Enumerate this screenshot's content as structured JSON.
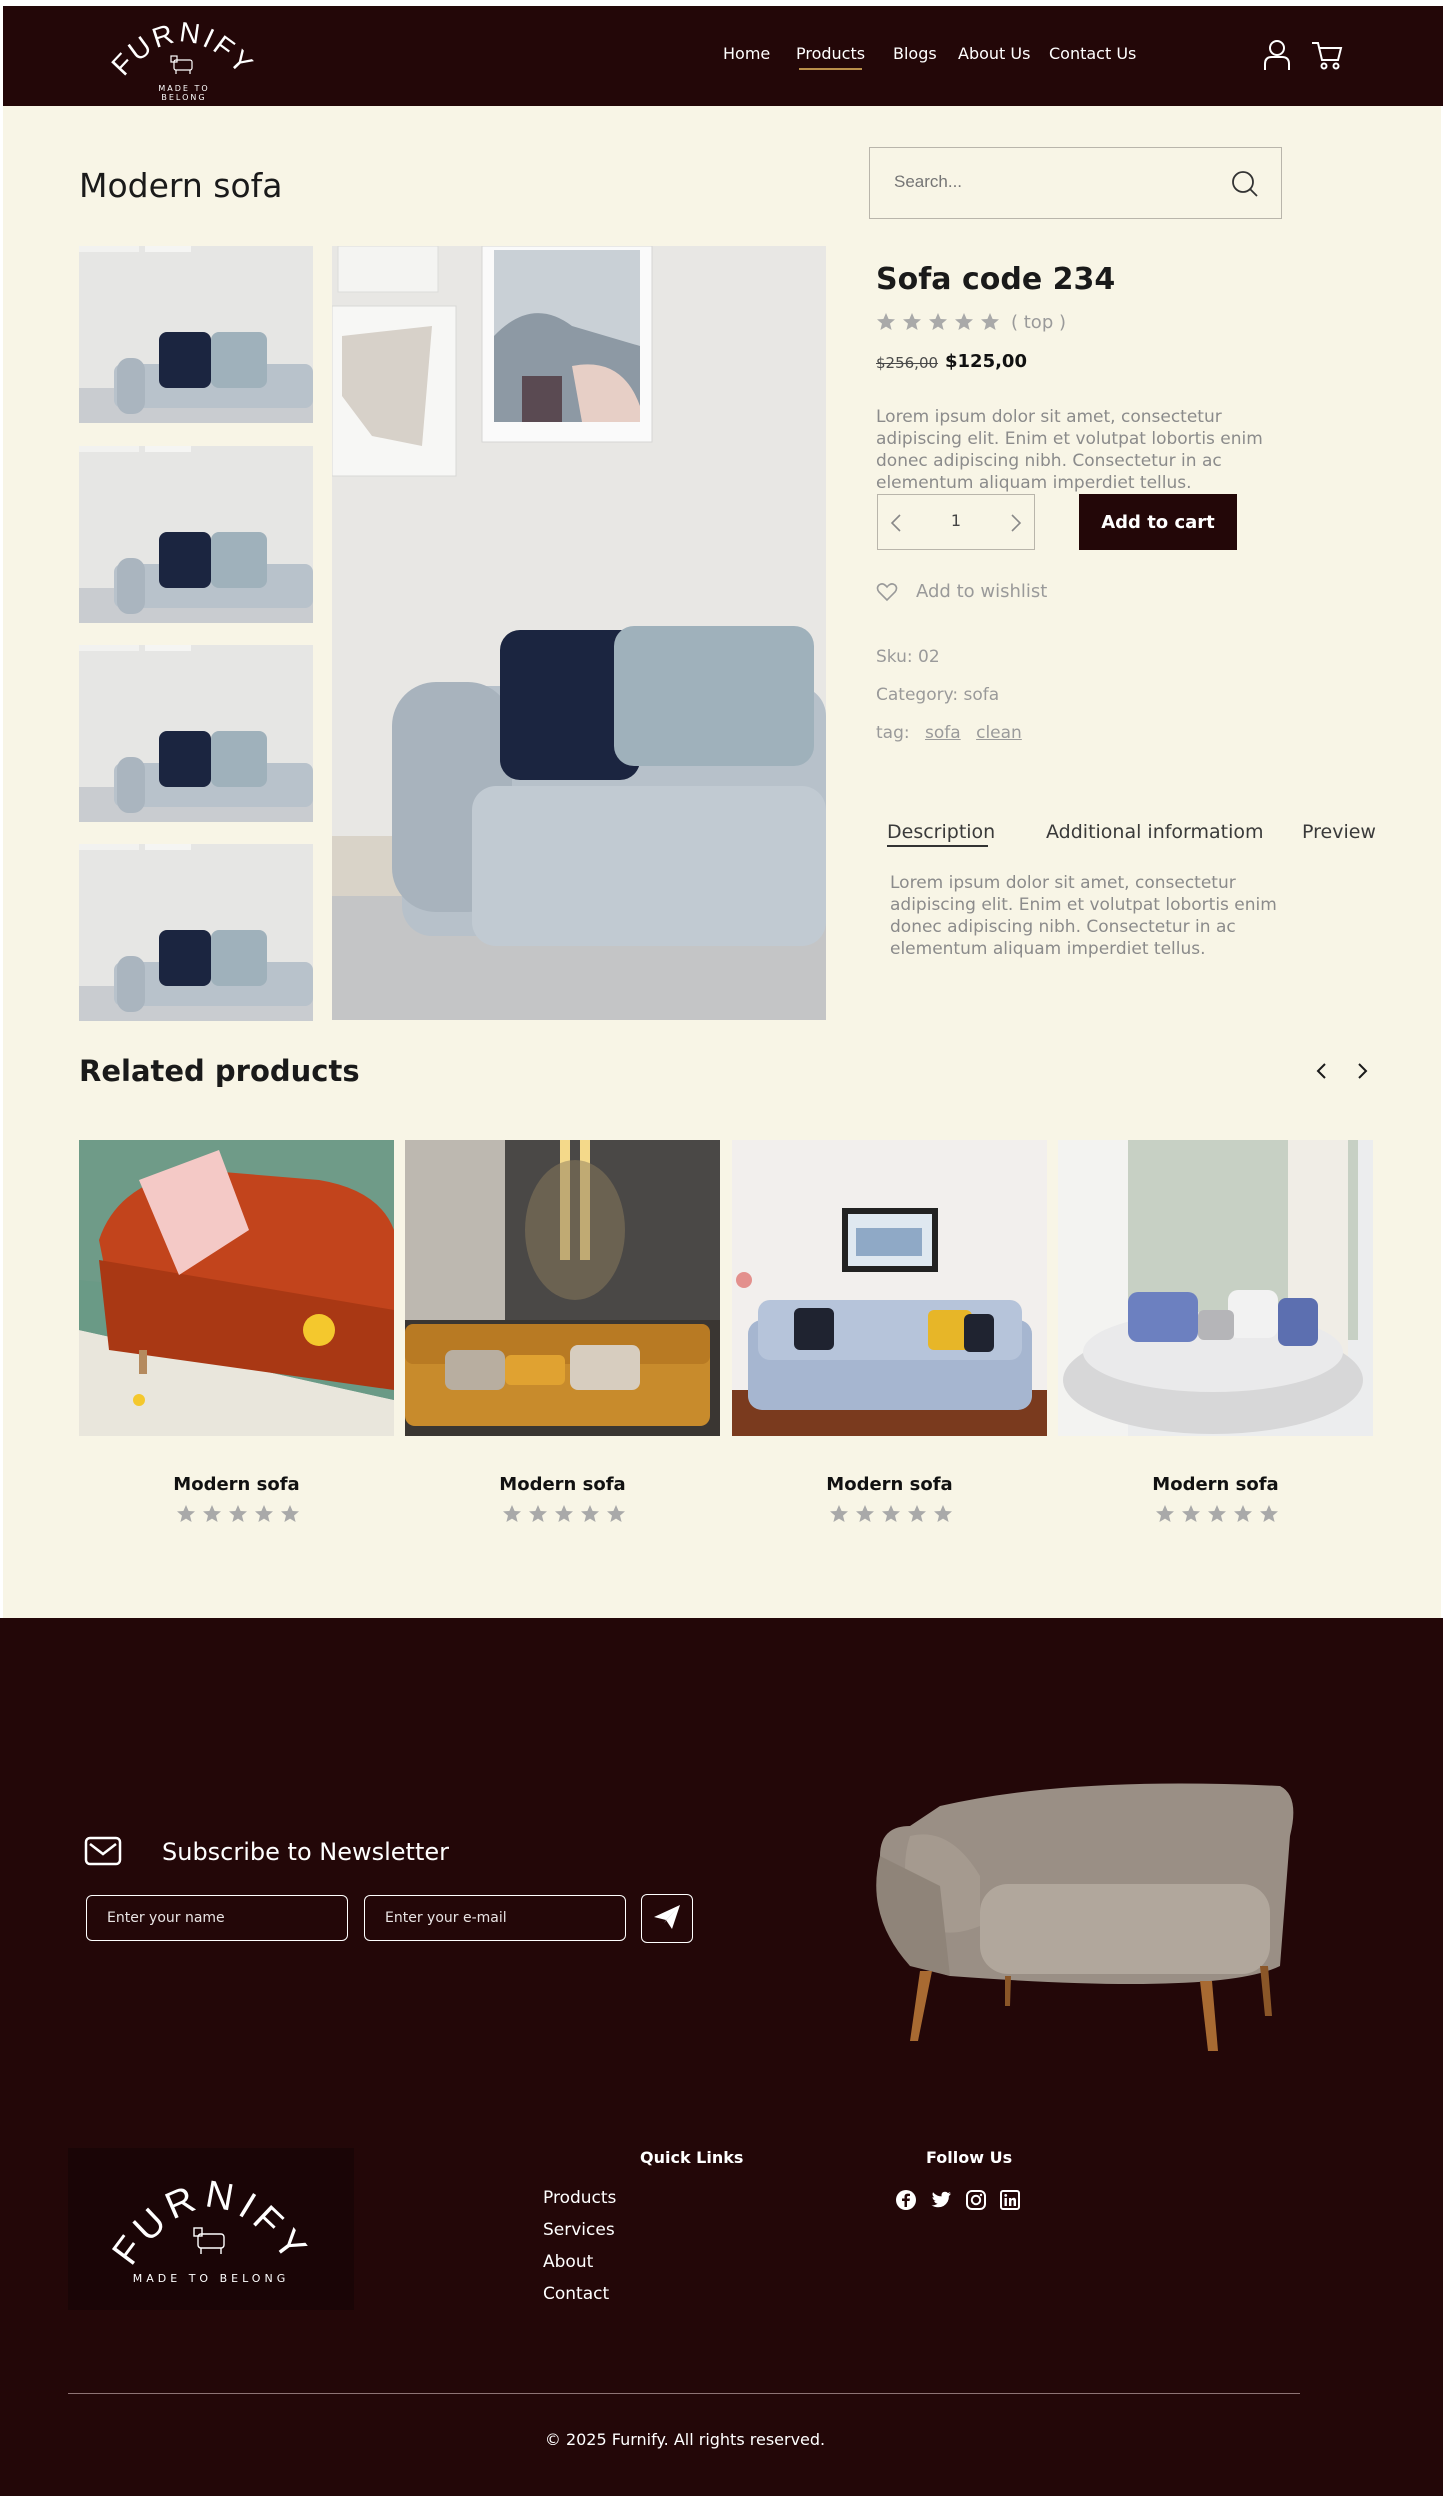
{
  "header": {
    "logo_text": "FURNIFY",
    "logo_tagline": "MADE TO BELONG",
    "nav": [
      "Home",
      "Products",
      "Blogs",
      "About Us",
      "Contact Us"
    ],
    "active_nav": "Products",
    "icons": [
      "user-icon",
      "cart-icon"
    ]
  },
  "page": {
    "title": "Modern sofa",
    "search_placeholder": "Search..."
  },
  "product": {
    "name": "Sofa code 234",
    "rating_label": "( top )",
    "rating_stars": 5,
    "old_price": "$256,00",
    "price": "$125,00",
    "description": "Lorem ipsum dolor sit amet, consectetur adipiscing elit. Enim et volutpat lobortis enim donec adipiscing nibh. Consectetur in ac elementum aliquam imperdiet tellus.",
    "quantity": "1",
    "add_to_cart": "Add to cart",
    "wishlist": "Add to wishlist",
    "sku": "Sku: 02",
    "category": "Category: sofa",
    "tag_label": "tag:",
    "tags": [
      "sofa",
      "clean"
    ]
  },
  "tabs": {
    "items": [
      "Description",
      "Additional informatiom",
      "Preview"
    ],
    "active": "Description",
    "content": "Lorem ipsum dolor sit amet, consectetur adipiscing elit. Enim et volutpat lobortis enim donec adipiscing nibh. Consectetur in ac elementum aliquam imperdiet tellus."
  },
  "related": {
    "title": "Related products",
    "items": [
      {
        "name": "Modern sofa",
        "stars": 5
      },
      {
        "name": "Modern sofa",
        "stars": 5
      },
      {
        "name": "Modern sofa",
        "stars": 5
      },
      {
        "name": "Modern sofa",
        "stars": 5
      }
    ]
  },
  "newsletter": {
    "title": "Subscribe to Newsletter",
    "name_placeholder": "Enter your name",
    "email_placeholder": "Enter your e-mail"
  },
  "footer": {
    "logo_text": "FURNIFY",
    "logo_tagline": "MADE TO BELONG",
    "quick_links_title": "Quick Links",
    "quick_links": [
      "Products",
      "Services",
      "About",
      "Contact"
    ],
    "follow_title": "Follow Us",
    "social": [
      "facebook-icon",
      "twitter-icon",
      "instagram-icon",
      "linkedin-icon"
    ],
    "copyright": "© 2025 Furnify. All rights reserved."
  },
  "colors": {
    "dark_maroon": "#230708",
    "cream": "#f8f5e6",
    "gold_accent": "#b98f4a",
    "star_gray": "#a9a9a9"
  }
}
